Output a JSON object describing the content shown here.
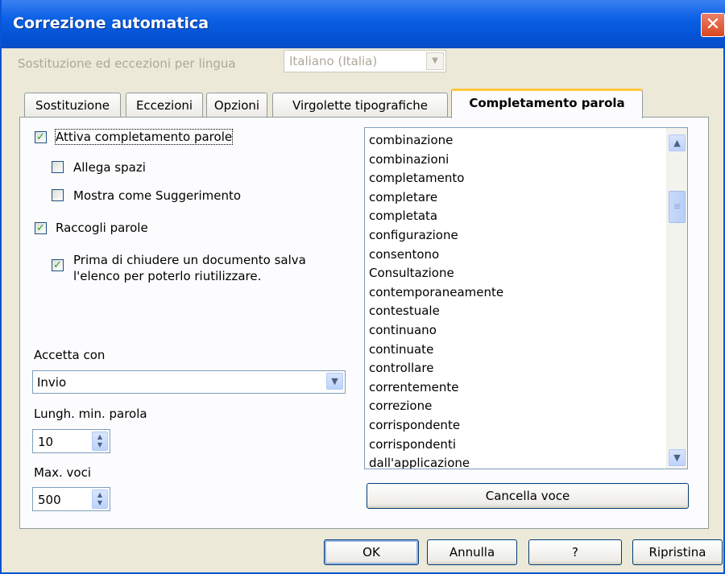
{
  "window": {
    "title": "Correzione automatica",
    "close_glyph": "✕"
  },
  "language": {
    "label": "Sostituzione ed eccezioni per lingua",
    "selected": "Italiano (Italia)"
  },
  "tabs": [
    {
      "label": "Sostituzione"
    },
    {
      "label": "Eccezioni"
    },
    {
      "label": "Opzioni"
    },
    {
      "label": "Virgolette tipografiche"
    },
    {
      "label": "Completamento parola"
    }
  ],
  "options": {
    "enable_completion": {
      "label": "Attiva completamento parole",
      "checked": true
    },
    "append_space": {
      "label": "Allega spazi",
      "checked": false
    },
    "show_as_tip": {
      "label": "Mostra come Suggerimento",
      "checked": false
    },
    "collect_words": {
      "label": "Raccogli parole",
      "checked": true
    },
    "save_list": {
      "label_line1": "Prima di chiudere un documento salva",
      "label_line2": "l'elenco per poterlo riutilizzare.",
      "checked": true
    }
  },
  "accept_with": {
    "label": "Accetta con",
    "value": "Invio"
  },
  "min_word_length": {
    "label": "Lungh. min. parola",
    "value": "10"
  },
  "max_entries": {
    "label": "Max. voci",
    "value": "500"
  },
  "word_list": [
    "combinazione",
    "combinazioni",
    "completamento",
    "completare",
    "completata",
    "configurazione",
    "consentono",
    "Consultazione",
    "contemporaneamente",
    "contestuale",
    "continuano",
    "continuate",
    "controllare",
    "correntemente",
    "correzione",
    "corrispondente",
    "corrispondenti",
    "dall'applicazione"
  ],
  "buttons": {
    "delete_entry": "Cancella voce",
    "ok": "OK",
    "cancel": "Annulla",
    "help": "?",
    "reset": "Ripristina"
  },
  "glyphs": {
    "check": "✓",
    "arrow_up": "▲",
    "arrow_down": "▼",
    "thumb": "≡"
  }
}
